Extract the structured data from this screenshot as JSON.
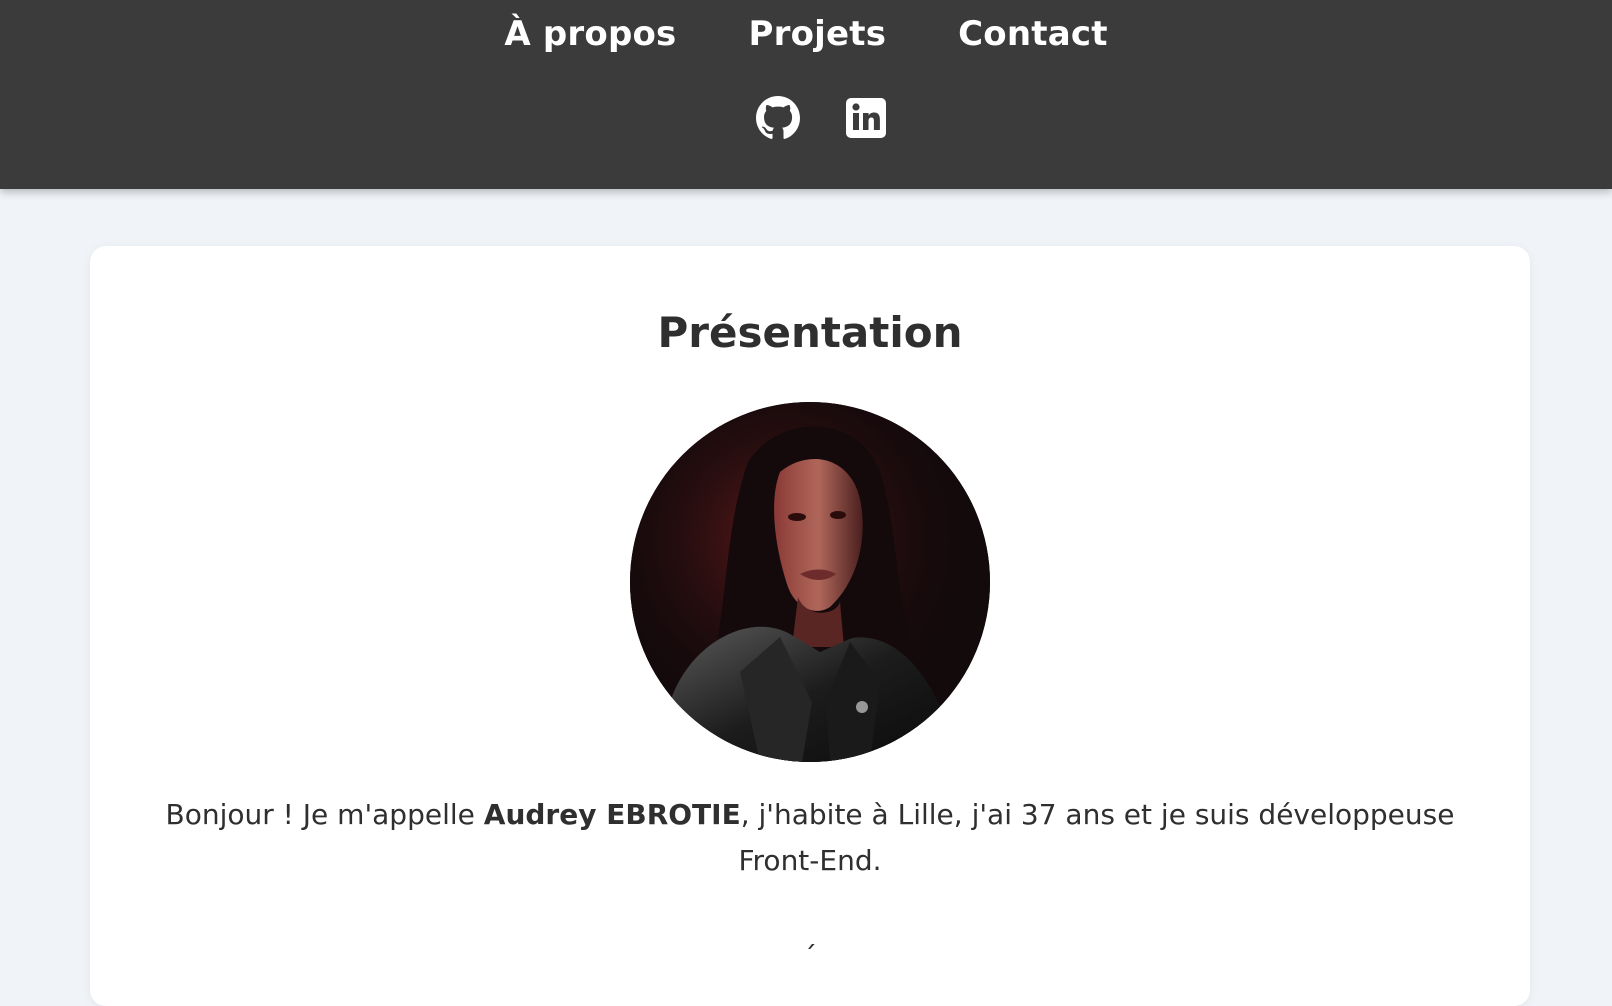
{
  "nav": {
    "items": [
      {
        "label": "À propos"
      },
      {
        "label": "Projets"
      },
      {
        "label": "Contact"
      }
    ]
  },
  "social": {
    "icons": [
      "github-icon",
      "linkedin-icon"
    ]
  },
  "presentation": {
    "title": "Présentation",
    "intro_before": "Bonjour ! Je m'appelle ",
    "name": "Audrey EBROTIE",
    "intro_after": ", j'habite à Lille, j'ai 37 ans et je suis développeuse Front-End.",
    "next_peek": "´"
  },
  "colors": {
    "header_bg": "#3b3b3b",
    "page_bg": "#f0f3f7",
    "card_bg": "#ffffff",
    "text": "#2f2f2f"
  }
}
